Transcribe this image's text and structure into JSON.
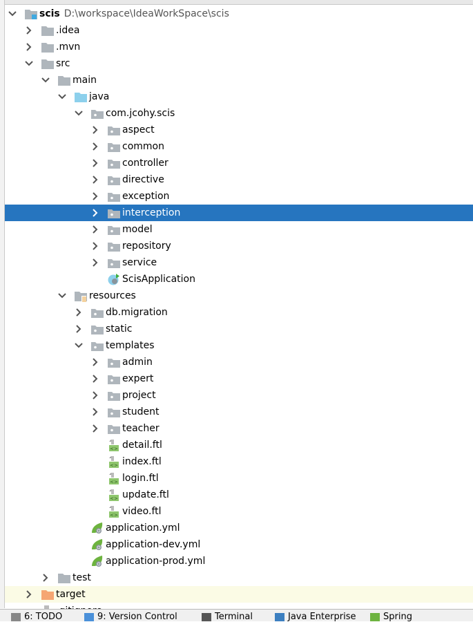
{
  "project_tree": {
    "root": {
      "name": "scis",
      "path": "D:\\workspace\\IdeaWorkSpace\\scis"
    },
    "items": [
      {
        "label": "scis",
        "level": 0,
        "chevron": "down",
        "icon": "module-folder-icon"
      },
      {
        "label": ".idea",
        "level": 1,
        "chevron": "right",
        "icon": "folder-icon"
      },
      {
        "label": ".mvn",
        "level": 1,
        "chevron": "right",
        "icon": "folder-icon"
      },
      {
        "label": "src",
        "level": 1,
        "chevron": "down",
        "icon": "folder-icon"
      },
      {
        "label": "main",
        "level": 2,
        "chevron": "down",
        "icon": "folder-icon"
      },
      {
        "label": "java",
        "level": 3,
        "chevron": "down",
        "icon": "source-folder-icon"
      },
      {
        "label": "com.jcohy.scis",
        "level": 4,
        "chevron": "down",
        "icon": "package-icon"
      },
      {
        "label": "aspect",
        "level": 5,
        "chevron": "right",
        "icon": "package-icon"
      },
      {
        "label": "common",
        "level": 5,
        "chevron": "right",
        "icon": "package-icon"
      },
      {
        "label": "controller",
        "level": 5,
        "chevron": "right",
        "icon": "package-icon"
      },
      {
        "label": "directive",
        "level": 5,
        "chevron": "right",
        "icon": "package-icon"
      },
      {
        "label": "exception",
        "level": 5,
        "chevron": "right",
        "icon": "package-icon"
      },
      {
        "label": "interception",
        "level": 5,
        "chevron": "right",
        "icon": "package-icon",
        "selected": true
      },
      {
        "label": "model",
        "level": 5,
        "chevron": "right",
        "icon": "package-icon"
      },
      {
        "label": "repository",
        "level": 5,
        "chevron": "right",
        "icon": "package-icon"
      },
      {
        "label": "service",
        "level": 5,
        "chevron": "right",
        "icon": "package-icon"
      },
      {
        "label": "ScisApplication",
        "level": 5,
        "chevron": "none",
        "icon": "spring-boot-class-icon"
      },
      {
        "label": "resources",
        "level": 3,
        "chevron": "down",
        "icon": "resources-folder-icon"
      },
      {
        "label": "db.migration",
        "level": 4,
        "chevron": "right",
        "icon": "package-icon"
      },
      {
        "label": "static",
        "level": 4,
        "chevron": "right",
        "icon": "package-icon"
      },
      {
        "label": "templates",
        "level": 4,
        "chevron": "down",
        "icon": "package-icon"
      },
      {
        "label": "admin",
        "level": 5,
        "chevron": "right",
        "icon": "package-icon"
      },
      {
        "label": "expert",
        "level": 5,
        "chevron": "right",
        "icon": "package-icon"
      },
      {
        "label": "project",
        "level": 5,
        "chevron": "right",
        "icon": "package-icon"
      },
      {
        "label": "student",
        "level": 5,
        "chevron": "right",
        "icon": "package-icon"
      },
      {
        "label": "teacher",
        "level": 5,
        "chevron": "right",
        "icon": "package-icon"
      },
      {
        "label": "detail.ftl",
        "level": 5,
        "chevron": "none",
        "icon": "ftl-file-icon"
      },
      {
        "label": "index.ftl",
        "level": 5,
        "chevron": "none",
        "icon": "ftl-file-icon"
      },
      {
        "label": "login.ftl",
        "level": 5,
        "chevron": "none",
        "icon": "ftl-file-icon"
      },
      {
        "label": "update.ftl",
        "level": 5,
        "chevron": "none",
        "icon": "ftl-file-icon"
      },
      {
        "label": "video.ftl",
        "level": 5,
        "chevron": "none",
        "icon": "ftl-file-icon"
      },
      {
        "label": "application.yml",
        "level": 4,
        "chevron": "none",
        "icon": "spring-config-icon"
      },
      {
        "label": "application-dev.yml",
        "level": 4,
        "chevron": "none",
        "icon": "spring-config-icon"
      },
      {
        "label": "application-prod.yml",
        "level": 4,
        "chevron": "none",
        "icon": "spring-config-icon"
      },
      {
        "label": "test",
        "level": 2,
        "chevron": "right",
        "icon": "folder-icon"
      },
      {
        "label": "target",
        "level": 1,
        "chevron": "right",
        "icon": "excluded-folder-icon",
        "excluded": true
      },
      {
        "label": ".gitignore",
        "level": 1,
        "chevron": "none",
        "icon": "file-icon"
      }
    ]
  },
  "bottom_toolbar": [
    {
      "label": "6: TODO",
      "icon": "todo-icon"
    },
    {
      "label": "9: Version Control",
      "icon": "version-control-icon"
    },
    {
      "label": "Terminal",
      "icon": "terminal-icon"
    },
    {
      "label": "Java Enterprise",
      "icon": "java-enterprise-icon"
    },
    {
      "label": "Spring",
      "icon": "spring-icon"
    }
  ],
  "colors": {
    "selection": "#2675bf",
    "excluded_row": "#fbfbe5",
    "folder": "#afb6bc",
    "source_folder": "#8dd0ec",
    "excluded_folder": "#f5a673",
    "spring": "#6db33f"
  }
}
